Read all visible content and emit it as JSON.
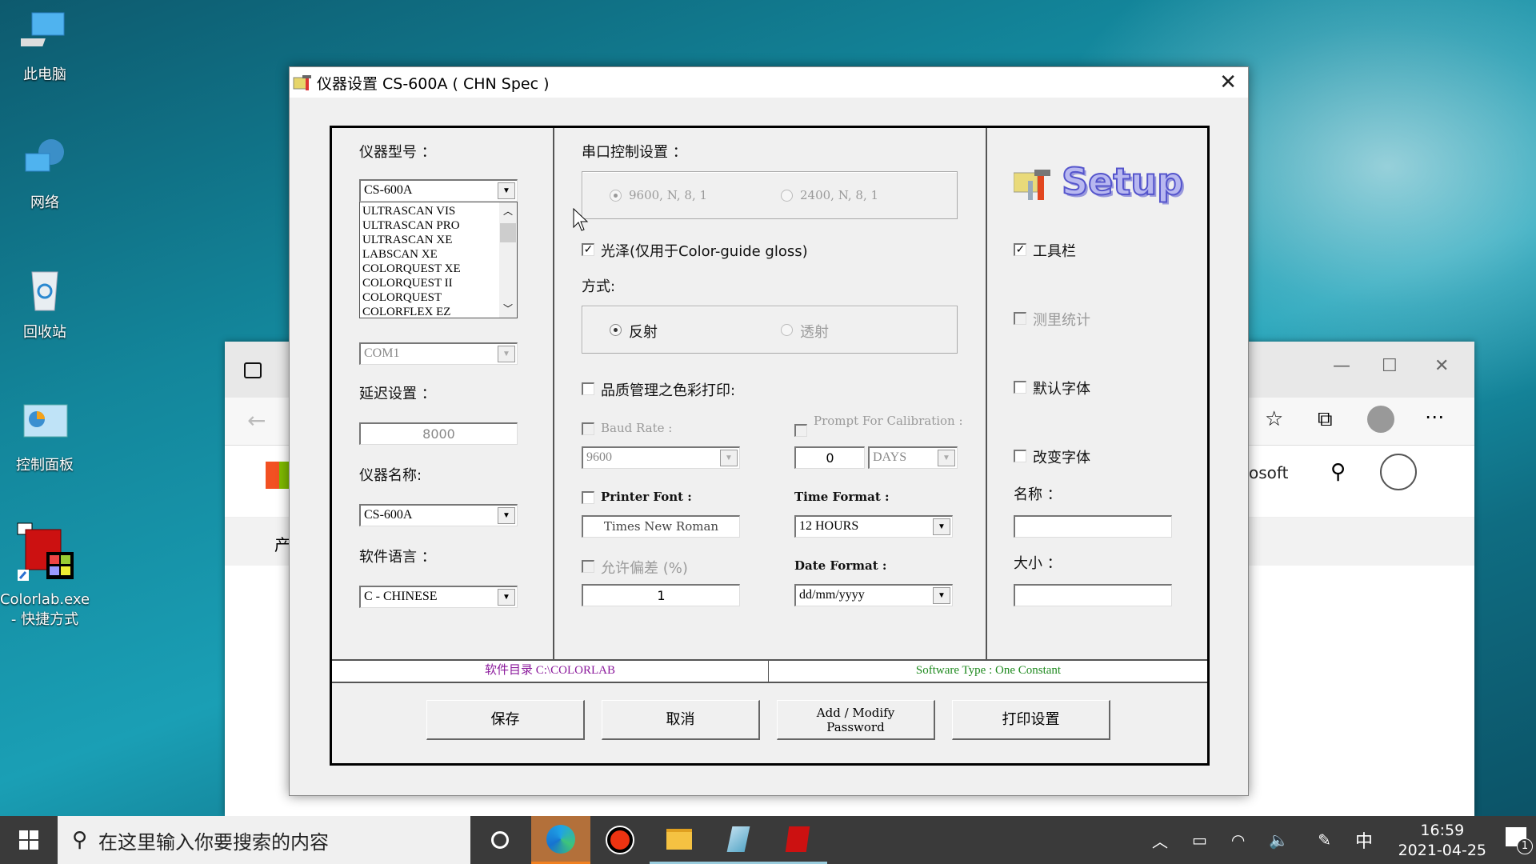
{
  "desktop": {
    "icons": [
      {
        "label": "此电脑",
        "icon": "computer-icon"
      },
      {
        "label": "网络",
        "icon": "network-icon"
      },
      {
        "label": "回收站",
        "icon": "recycle-bin-icon"
      },
      {
        "label": "控制面板",
        "icon": "control-panel-icon"
      },
      {
        "label": "Colorlab.exe - 快捷方式",
        "icon": "colorlab-shortcut-icon"
      }
    ]
  },
  "browser": {
    "partial_text": "osoft",
    "nav_partial": "产"
  },
  "dialog": {
    "title": "仪器设置 CS-600A ( CHN Spec )",
    "left": {
      "model_label": "仪器型号 ：",
      "model_value": "CS-600A",
      "model_list": [
        "ULTRASCAN VIS",
        "ULTRASCAN PRO",
        "ULTRASCAN XE",
        "LABSCAN XE",
        "COLORQUEST XE",
        "COLORQUEST II",
        "COLORQUEST",
        "COLORFLEX EZ"
      ],
      "port_value": "COM1",
      "delay_label": "延迟设置 ：",
      "delay_value": "8000",
      "name_label": "仪器名称:",
      "name_value": "CS-600A",
      "language_label": "软件语言 ：",
      "language_value": "C - CHINESE"
    },
    "middle": {
      "serial_label": "串口控制设置 ：",
      "serial_options": [
        {
          "label": "9600, N, 8, 1",
          "selected": true,
          "disabled": true
        },
        {
          "label": "2400, N, 8, 1",
          "selected": false,
          "disabled": true
        }
      ],
      "gloss_label": "光泽(仅用于Color-guide gloss)",
      "gloss_checked": true,
      "mode_label": "方式:",
      "mode_options": [
        {
          "label": "反射",
          "selected": true,
          "disabled": false
        },
        {
          "label": "透射",
          "selected": false,
          "disabled": true
        }
      ],
      "qc_print_label": "品质管理之色彩打印:",
      "qc_print_checked": false,
      "baud_label": "Baud Rate :",
      "baud_value": "9600",
      "calib_label": "Prompt For Calibration :",
      "calib_value": "0",
      "calib_unit": "DAYS",
      "printer_font_label": "Printer Font :",
      "printer_font_value": "Times New Roman",
      "time_format_label": "Time Format :",
      "time_format_value": "12 HOURS",
      "tolerance_label": "允许偏差 (%)",
      "tolerance_value": "1",
      "date_format_label": "Date Format :",
      "date_format_value": "dd/mm/yyyy"
    },
    "right": {
      "setup_logo": "Setup",
      "toolbar_label": "工具栏",
      "toolbar_checked": true,
      "stats_label": "测里统计",
      "stats_checked": false,
      "default_font_label": "默认字体",
      "default_font_checked": false,
      "change_font_label": "改变字体",
      "change_font_checked": false,
      "font_name_label": "名称 ：",
      "font_name_value": "",
      "font_size_label": "大小 ：",
      "font_size_value": ""
    },
    "status": {
      "directory": "软件目录 C:\\COLORLAB",
      "directory_color": "#8b1a9c",
      "software_type": "Software Type : One Constant",
      "software_type_color": "#1f8a1f"
    },
    "buttons": {
      "save": "保存",
      "cancel": "取消",
      "password_line1": "Add / Modify",
      "password_line2": "Password",
      "print_settings": "打印设置"
    }
  },
  "taskbar": {
    "search_placeholder": "在这里输入你要搜索的内容",
    "ime": "中",
    "time": "16:59",
    "date": "2021-04-25",
    "notification_count": "1"
  }
}
